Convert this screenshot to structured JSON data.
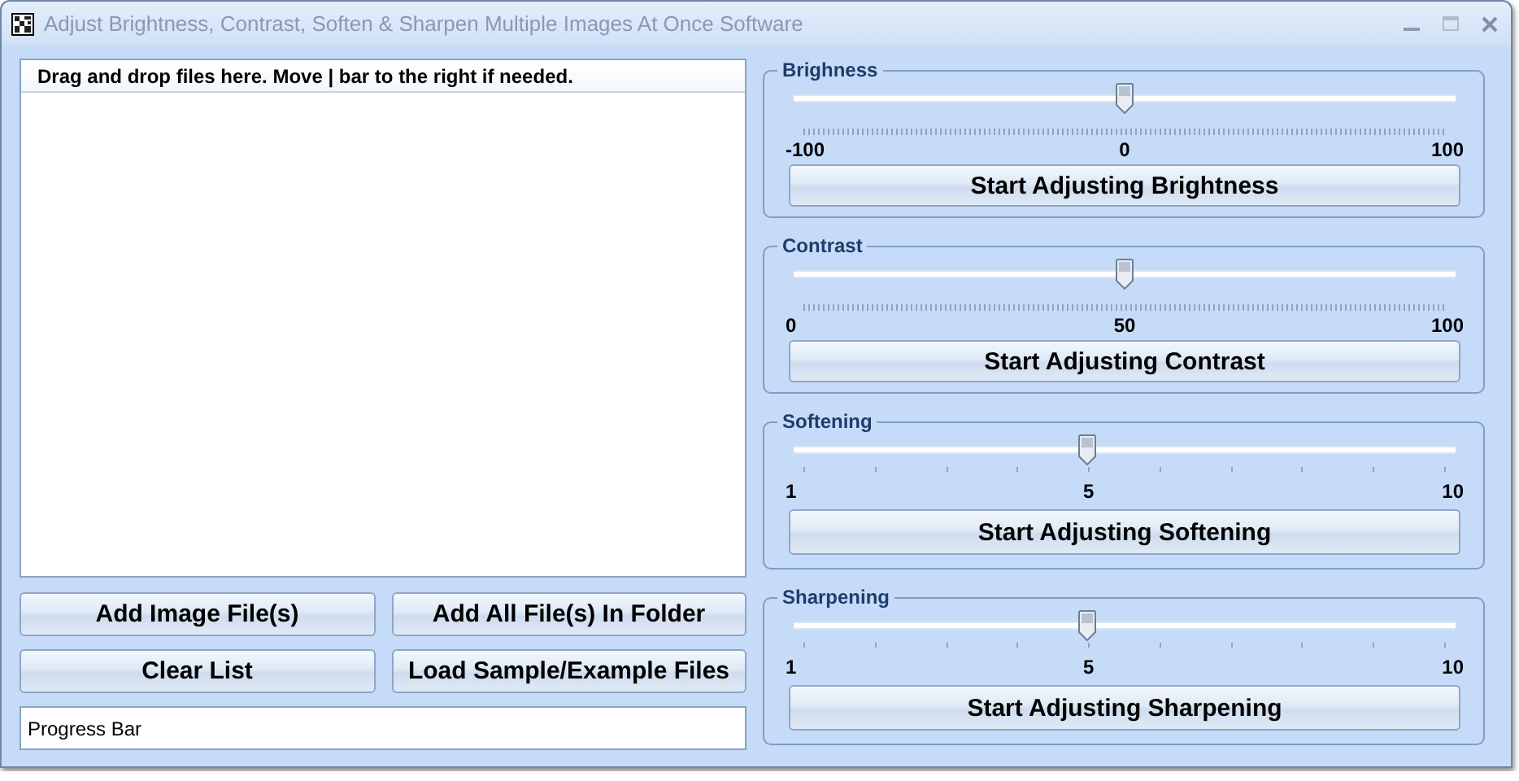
{
  "window": {
    "title": "Adjust Brightness, Contrast, Soften & Sharpen Multiple Images At Once Software"
  },
  "file_list": {
    "header": "Drag and drop files here. Move | bar to the right if needed."
  },
  "buttons": [
    {
      "label": "Add Image File(s)"
    },
    {
      "label": "Add All File(s) In Folder"
    },
    {
      "label": "Clear List"
    },
    {
      "label": "Load Sample/Example Files"
    }
  ],
  "progress_bar": {
    "label": "Progress Bar"
  },
  "groups": [
    {
      "title": "Brighness",
      "kind": "fine",
      "level": 0.5,
      "min": "-100",
      "mid": "0",
      "max": "100",
      "button": "Start Adjusting Brightness"
    },
    {
      "title": "Contrast",
      "kind": "fine",
      "level": 0.5,
      "min": "0",
      "mid": "50",
      "max": "100",
      "button": "Start Adjusting Contrast"
    },
    {
      "title": "Softening",
      "kind": "steps",
      "level": 0.444,
      "min": "1",
      "mid": "5",
      "max": "10",
      "button": "Start Adjusting Softening"
    },
    {
      "title": "Sharpening",
      "kind": "steps",
      "level": 0.444,
      "min": "1",
      "mid": "5",
      "max": "10",
      "button": "Start Adjusting Sharpening"
    }
  ]
}
